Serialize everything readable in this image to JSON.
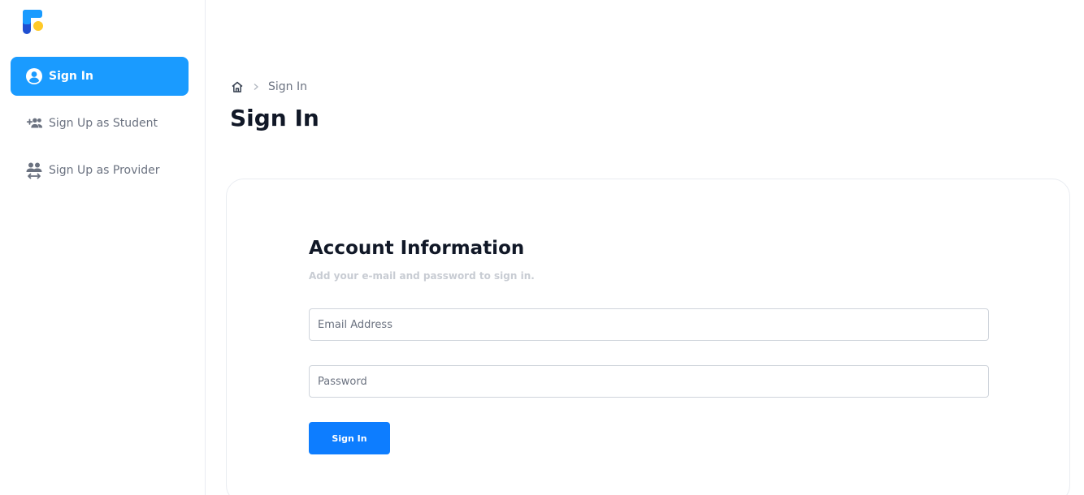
{
  "sidebar": {
    "logo": "app-logo",
    "items": [
      {
        "label": "Sign In",
        "icon": "user-circle-icon",
        "active": true
      },
      {
        "label": "Sign Up as Student",
        "icon": "add-group-icon",
        "active": false
      },
      {
        "label": "Sign Up as Provider",
        "icon": "group-swap-icon",
        "active": false
      }
    ]
  },
  "breadcrumb": {
    "home_icon": "home-icon",
    "separator_icon": "chevron-right-icon",
    "current": "Sign In"
  },
  "page": {
    "title": "Sign In"
  },
  "form": {
    "title": "Account Information",
    "subtitle": "Add your e-mail and password to sign in.",
    "email": {
      "placeholder": "Email Address",
      "value": ""
    },
    "password": {
      "placeholder": "Password",
      "value": ""
    },
    "submit_label": "Sign In"
  },
  "colors": {
    "active_nav": "#1a9bff",
    "primary_button": "#0d7dff",
    "logo_blue": "#1a9bff",
    "logo_dark_blue": "#1f4fd1",
    "logo_yellow": "#ffc928"
  }
}
